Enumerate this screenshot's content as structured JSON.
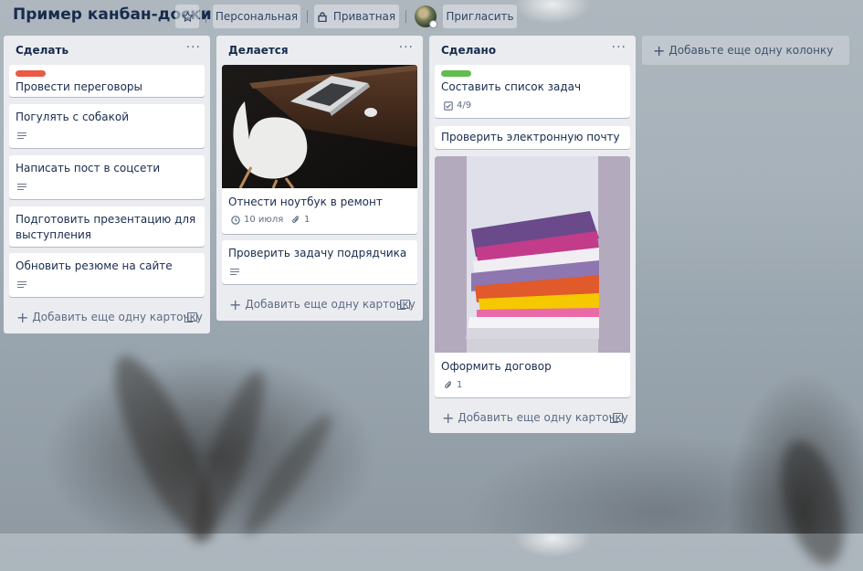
{
  "header": {
    "board_title": "Пример канбан-доски",
    "visibility_team": "Персональная",
    "visibility_privacy": "Приватная",
    "invite_label": "Пригласить"
  },
  "lists": [
    {
      "title": "Сделать",
      "menu_icon": "···",
      "cards": [
        {
          "label_color": "#eb5a46",
          "title": "Провести переговоры"
        },
        {
          "title": "Погулять с собакой",
          "has_description": true
        },
        {
          "title": "Написать пост в соцсети",
          "has_description": true
        },
        {
          "title_line1": "Подготовить презентацию для",
          "title_line2": "выступления"
        },
        {
          "title": "Обновить резюме на сайте",
          "has_description": true
        }
      ],
      "add_card_label": "Добавить еще одну карточку"
    },
    {
      "title": "Делается",
      "menu_icon": "···",
      "cards": [
        {
          "cover": "laptop-desk-photo",
          "title": "Отнести ноутбук в ремонт",
          "due_date": "10 июля",
          "attachments": "1"
        },
        {
          "title": "Проверить задачу подрядчика",
          "has_description": true
        }
      ],
      "add_card_label": "Добавить еще одну карточку"
    },
    {
      "title": "Сделано",
      "menu_icon": "···",
      "cards": [
        {
          "label_color": "#61bd4f",
          "title": "Составить список задач",
          "checklist": "4/9"
        },
        {
          "title": "Проверить электронную почту"
        },
        {
          "cover": "paper-stack-photo",
          "title": "Оформить договор",
          "attachments": "1"
        }
      ],
      "add_card_label": "Добавить еще одну карточку"
    }
  ],
  "add_list_label": "Добавьте еще одну колонку"
}
